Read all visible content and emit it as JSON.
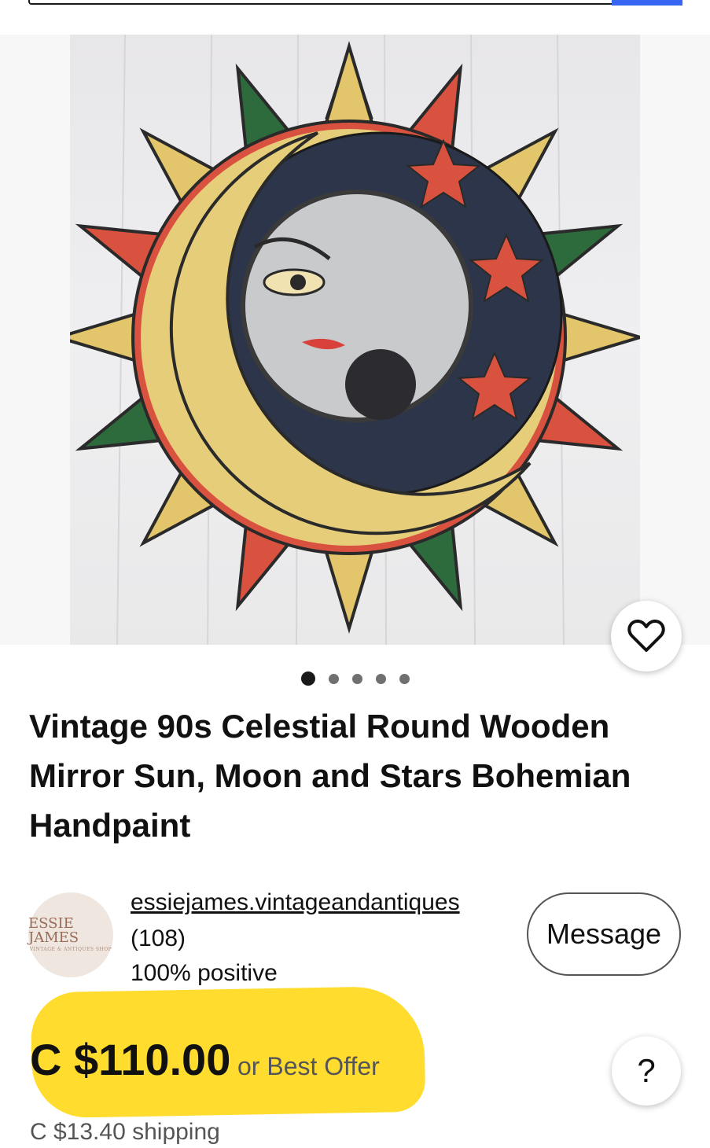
{
  "listing": {
    "title": "Vintage 90s Celestial Round Wooden Mirror Sun, Moon and Stars Bohemian Handpaint",
    "image_count": 5,
    "active_image": 1
  },
  "seller": {
    "name": "essiejames.vintageandantiques",
    "feedback_count": "(108)",
    "positive": "100% positive",
    "avatar_text": "ESSIE JAMES",
    "avatar_subtext": "VINTAGE & ANTIQUES SHOP",
    "message_label": "Message"
  },
  "pricing": {
    "price": "C $110.00",
    "offer": "or Best Offer",
    "shipping": "C $13.40 shipping"
  },
  "help": {
    "label": "?"
  },
  "icons": {
    "favorite": "heart-icon",
    "help": "question-icon"
  },
  "colors": {
    "accent_blue": "#3665f3",
    "highlight": "#ffd400",
    "text": "#111111",
    "secondary_text": "#555555"
  }
}
